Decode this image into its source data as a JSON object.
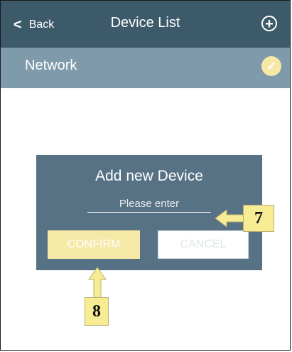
{
  "header": {
    "back_label": "Back",
    "back_icon": "chevron-left-icon",
    "title": "Device List",
    "add_icon": "plus-circle-icon"
  },
  "network": {
    "label": "Network",
    "status_icon": "check-circle-icon"
  },
  "dialog": {
    "title": "Add new Device",
    "input_placeholder": "Please enter",
    "input_value": "",
    "confirm_label": "CONFIRM",
    "cancel_label": "CANCEL"
  },
  "annotations": {
    "step_7": "7",
    "step_8": "8"
  },
  "colors": {
    "header_bg": "#3d5a6a",
    "subheader_bg": "#7f9aab",
    "dialog_bg": "#577284",
    "confirm_bg": "#f6e8a7",
    "callout_bg": "#f7eb93"
  }
}
